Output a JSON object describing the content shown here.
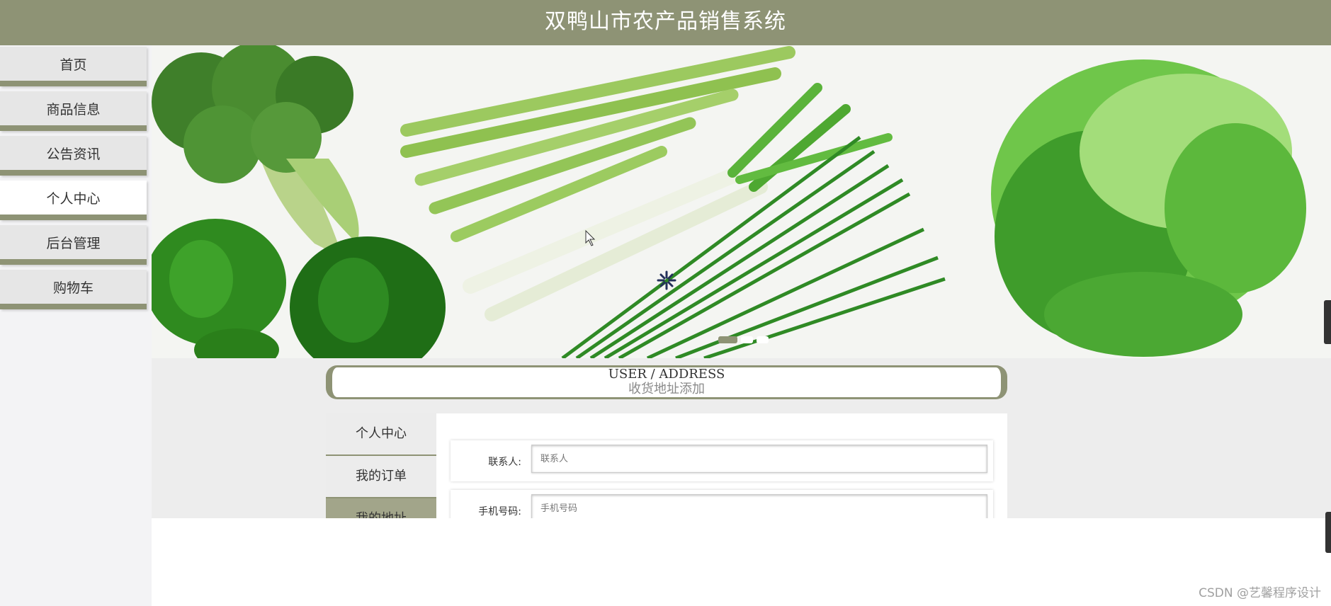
{
  "header": {
    "title": "双鸭山市农产品销售系统"
  },
  "sidebar": {
    "items": [
      {
        "label": "首页"
      },
      {
        "label": "商品信息"
      },
      {
        "label": "公告资讯"
      },
      {
        "label": "个人中心"
      },
      {
        "label": "后台管理"
      },
      {
        "label": "购物车"
      }
    ],
    "active_index": 3
  },
  "banner": {
    "image_description": "vegetables",
    "slide_count": 3,
    "active_slide": 1
  },
  "section_title": {
    "en": "USER / ADDRESS",
    "cn": "收货地址添加"
  },
  "tabs": [
    {
      "label": "个人中心"
    },
    {
      "label": "我的订单"
    },
    {
      "label": "我的地址"
    }
  ],
  "form": {
    "contact": {
      "label": "联系人:",
      "placeholder": "联系人"
    },
    "phone": {
      "label": "手机号码:",
      "placeholder": "手机号码"
    }
  },
  "watermark": "CSDN @艺馨程序设计",
  "colors": {
    "accent": "#8e9375",
    "tab_active": "#a2a58a"
  }
}
